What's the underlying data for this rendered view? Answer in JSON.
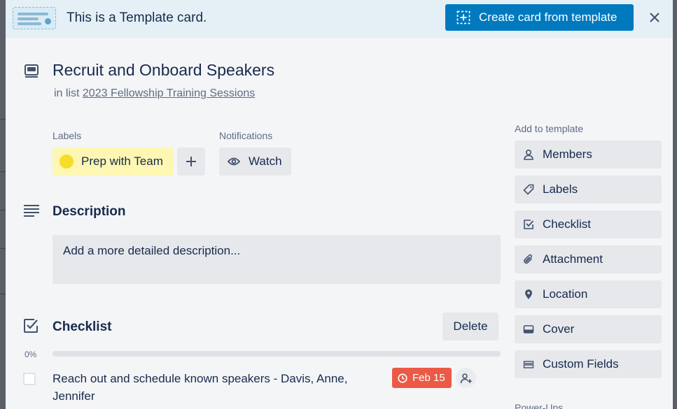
{
  "banner": {
    "text": "This is a Template card.",
    "create_button_label": "Create card from template"
  },
  "card": {
    "title": "Recruit and Onboard Speakers",
    "in_list_prefix": "in list",
    "list_name": "2023 Fellowship Training Sessions"
  },
  "labels": {
    "heading": "Labels",
    "items": [
      {
        "text": "Prep with Team",
        "color": "#f5dd29"
      }
    ]
  },
  "notifications": {
    "heading": "Notifications",
    "watch_label": "Watch"
  },
  "description": {
    "heading": "Description",
    "placeholder": "Add a more detailed description..."
  },
  "checklist": {
    "heading": "Checklist",
    "delete_label": "Delete",
    "progress_text": "0%",
    "progress_fraction": 0,
    "items": [
      {
        "text": "Reach out and schedule known speakers - Davis, Anne, Jennifer",
        "checked": false,
        "due": "Feb 15",
        "due_color": "#eb5a46"
      }
    ]
  },
  "sidebar": {
    "add_to_template_heading": "Add to template",
    "buttons": [
      {
        "label": "Members",
        "icon": "person-icon"
      },
      {
        "label": "Labels",
        "icon": "tag-icon"
      },
      {
        "label": "Checklist",
        "icon": "checkbox-icon"
      },
      {
        "label": "Attachment",
        "icon": "paperclip-icon"
      },
      {
        "label": "Location",
        "icon": "location-pin-icon"
      },
      {
        "label": "Cover",
        "icon": "cover-icon"
      },
      {
        "label": "Custom Fields",
        "icon": "custom-fields-icon"
      }
    ],
    "powerups_heading": "Power-Ups"
  },
  "colors": {
    "primary": "#0079bf",
    "banner_bg": "#e4f0f6",
    "modal_bg": "#f4f5f7",
    "button_bg": "#e6e8ec",
    "text": "#172b4d",
    "muted_text": "#5e6c84"
  }
}
